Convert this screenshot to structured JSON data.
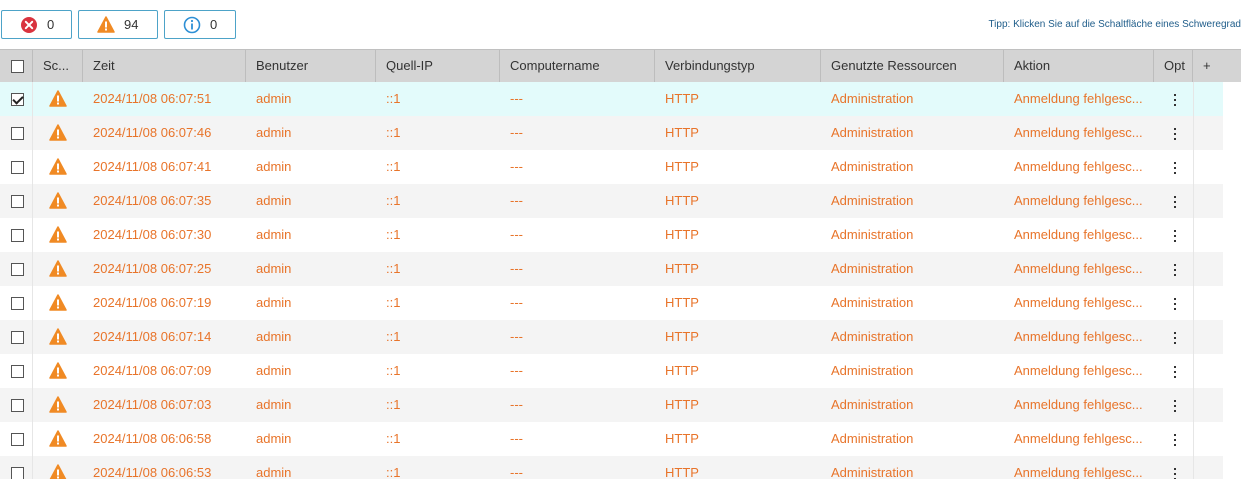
{
  "filters": {
    "error_count": "0",
    "warning_count": "94",
    "info_count": "0",
    "colors": {
      "error": "#d9333f",
      "warning": "#f08a24",
      "info": "#2d8fd5",
      "border": "#4da3c8"
    }
  },
  "tip": "Tipp: Klicken Sie auf die Schaltfläche eines Schweregrad",
  "columns": {
    "severity": "Sc...",
    "time": "Zeit",
    "user": "Benutzer",
    "source_ip": "Quell-IP",
    "computer": "Computername",
    "conn_type": "Verbindungstyp",
    "resources": "Genutzte Ressourcen",
    "action": "Aktion",
    "options": "Opt",
    "add": "+"
  },
  "row_color": "#e8742a",
  "rows": [
    {
      "checked": true,
      "severity": "warning-icon",
      "time": "2024/11/08 06:07:51",
      "user": "admin",
      "ip": "::1",
      "computer": "---",
      "conn": "HTTP",
      "res": "Administration",
      "action": "Anmeldung fehlgesc..."
    },
    {
      "checked": false,
      "severity": "warning-icon",
      "time": "2024/11/08 06:07:46",
      "user": "admin",
      "ip": "::1",
      "computer": "---",
      "conn": "HTTP",
      "res": "Administration",
      "action": "Anmeldung fehlgesc..."
    },
    {
      "checked": false,
      "severity": "warning-icon",
      "time": "2024/11/08 06:07:41",
      "user": "admin",
      "ip": "::1",
      "computer": "---",
      "conn": "HTTP",
      "res": "Administration",
      "action": "Anmeldung fehlgesc..."
    },
    {
      "checked": false,
      "severity": "warning-icon",
      "time": "2024/11/08 06:07:35",
      "user": "admin",
      "ip": "::1",
      "computer": "---",
      "conn": "HTTP",
      "res": "Administration",
      "action": "Anmeldung fehlgesc..."
    },
    {
      "checked": false,
      "severity": "warning-icon",
      "time": "2024/11/08 06:07:30",
      "user": "admin",
      "ip": "::1",
      "computer": "---",
      "conn": "HTTP",
      "res": "Administration",
      "action": "Anmeldung fehlgesc..."
    },
    {
      "checked": false,
      "severity": "warning-icon",
      "time": "2024/11/08 06:07:25",
      "user": "admin",
      "ip": "::1",
      "computer": "---",
      "conn": "HTTP",
      "res": "Administration",
      "action": "Anmeldung fehlgesc..."
    },
    {
      "checked": false,
      "severity": "warning-icon",
      "time": "2024/11/08 06:07:19",
      "user": "admin",
      "ip": "::1",
      "computer": "---",
      "conn": "HTTP",
      "res": "Administration",
      "action": "Anmeldung fehlgesc..."
    },
    {
      "checked": false,
      "severity": "warning-icon",
      "time": "2024/11/08 06:07:14",
      "user": "admin",
      "ip": "::1",
      "computer": "---",
      "conn": "HTTP",
      "res": "Administration",
      "action": "Anmeldung fehlgesc..."
    },
    {
      "checked": false,
      "severity": "warning-icon",
      "time": "2024/11/08 06:07:09",
      "user": "admin",
      "ip": "::1",
      "computer": "---",
      "conn": "HTTP",
      "res": "Administration",
      "action": "Anmeldung fehlgesc..."
    },
    {
      "checked": false,
      "severity": "warning-icon",
      "time": "2024/11/08 06:07:03",
      "user": "admin",
      "ip": "::1",
      "computer": "---",
      "conn": "HTTP",
      "res": "Administration",
      "action": "Anmeldung fehlgesc..."
    },
    {
      "checked": false,
      "severity": "warning-icon",
      "time": "2024/11/08 06:06:58",
      "user": "admin",
      "ip": "::1",
      "computer": "---",
      "conn": "HTTP",
      "res": "Administration",
      "action": "Anmeldung fehlgesc..."
    },
    {
      "checked": false,
      "severity": "warning-icon",
      "time": "2024/11/08 06:06:53",
      "user": "admin",
      "ip": "::1",
      "computer": "---",
      "conn": "HTTP",
      "res": "Administration",
      "action": "Anmeldung fehlgesc..."
    }
  ]
}
